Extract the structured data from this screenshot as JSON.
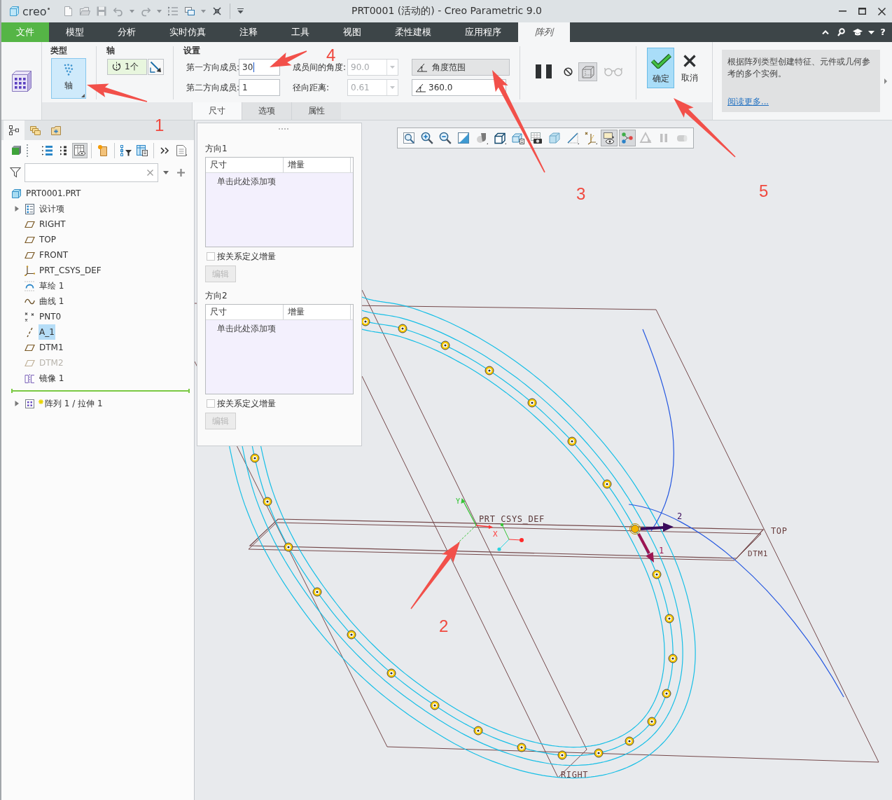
{
  "title_bar": {
    "logo": "creo",
    "title": "PRT0001 (活动的) - Creo Parametric 9.0"
  },
  "menu_bar": {
    "tabs": [
      {
        "label": "文件",
        "kind": "file",
        "selected": false
      },
      {
        "label": "模型",
        "kind": "tab",
        "selected": false
      },
      {
        "label": "分析",
        "kind": "tab",
        "selected": false
      },
      {
        "label": "实时仿真",
        "kind": "tab",
        "selected": false
      },
      {
        "label": "注释",
        "kind": "tab",
        "selected": false
      },
      {
        "label": "工具",
        "kind": "tab",
        "selected": false
      },
      {
        "label": "视图",
        "kind": "tab",
        "selected": false
      },
      {
        "label": "柔性建模",
        "kind": "tab",
        "selected": false
      },
      {
        "label": "应用程序",
        "kind": "tab",
        "selected": false
      },
      {
        "label": "阵列",
        "kind": "tab",
        "selected": true
      }
    ],
    "help_button": "?"
  },
  "ribbon": {
    "type_group": {
      "title": "类型",
      "button": {
        "label": "轴",
        "selected": true
      }
    },
    "axis_group": {
      "title": "轴",
      "collector": "1个"
    },
    "settings_group": {
      "title": "设置",
      "fields": [
        {
          "label": "第一方向成员:",
          "value": "30",
          "kind": "spin",
          "disabled": false,
          "focused": true
        },
        {
          "label": "成员间的角度:",
          "value": "90.0",
          "kind": "combo",
          "disabled": true,
          "focused": false
        },
        {
          "label": "第二方向成员:",
          "value": "1",
          "kind": "spin",
          "disabled": false,
          "focused": false
        },
        {
          "label": "径向距离:",
          "value": "0.61",
          "kind": "combo",
          "disabled": true,
          "focused": false
        }
      ],
      "angle_range_button": "角度范围",
      "angle_value": "360.0"
    },
    "tools": [
      {
        "kind": "pause",
        "pressed": false,
        "disabled": false
      },
      {
        "kind": "stop",
        "pressed": false,
        "disabled": false
      },
      {
        "kind": "preview",
        "pressed": true,
        "disabled": false
      },
      {
        "kind": "verify",
        "pressed": false,
        "disabled": true
      }
    ],
    "confirm_button": "确定",
    "cancel_button": "取消",
    "help": {
      "text": "根据阵列类型创建特征、元件或几何参考的多个实例。",
      "link": "阅读更多..."
    },
    "panel_tabs": [
      {
        "label": "尺寸",
        "selected": true
      },
      {
        "label": "选项",
        "selected": false
      },
      {
        "label": "属性",
        "selected": false
      }
    ]
  },
  "model_tree": {
    "tabs": [
      {
        "kind": "tree",
        "selected": true
      },
      {
        "kind": "layers",
        "selected": false
      },
      {
        "kind": "folder",
        "selected": false
      }
    ],
    "toolbar": [
      {
        "kind": "display",
        "pressed": false
      },
      {
        "kind": "tree-list",
        "pressed": false
      },
      {
        "kind": "expand",
        "pressed": false
      },
      {
        "kind": "columns",
        "pressed": true
      },
      {
        "kind": "highlight",
        "pressed": false
      },
      {
        "kind": "tree-filter",
        "pressed": false
      },
      {
        "kind": "tree-columns",
        "pressed": false
      },
      {
        "kind": "more",
        "pressed": false
      },
      {
        "kind": "settings",
        "pressed": false
      }
    ],
    "root": {
      "label": "PRT0001.PRT",
      "kind": "part",
      "selected": false,
      "children": [
        {
          "label": "设计项",
          "kind": "group",
          "selected": false,
          "greyed": false,
          "new": false,
          "expanded": false
        },
        {
          "label": "RIGHT",
          "kind": "plane",
          "selected": false,
          "greyed": false,
          "new": false
        },
        {
          "label": "TOP",
          "kind": "plane",
          "selected": false,
          "greyed": false,
          "new": false
        },
        {
          "label": "FRONT",
          "kind": "plane",
          "selected": false,
          "greyed": false,
          "new": false
        },
        {
          "label": "PRT_CSYS_DEF",
          "kind": "csys",
          "selected": false,
          "greyed": false,
          "new": false
        },
        {
          "label": "草绘 1",
          "kind": "sketch",
          "selected": false,
          "greyed": false,
          "new": false
        },
        {
          "label": "曲线 1",
          "kind": "curve",
          "selected": false,
          "greyed": false,
          "new": false
        },
        {
          "label": "PNT0",
          "kind": "point",
          "selected": false,
          "greyed": false,
          "new": false
        },
        {
          "label": "A_1",
          "kind": "axis",
          "selected": true,
          "greyed": false,
          "new": false
        },
        {
          "label": "DTM1",
          "kind": "plane",
          "selected": false,
          "greyed": false,
          "new": false
        },
        {
          "label": "DTM2",
          "kind": "plane",
          "selected": false,
          "greyed": true,
          "new": false
        },
        {
          "label": "镜像 1",
          "kind": "mirror",
          "selected": false,
          "greyed": false,
          "new": false
        },
        {
          "label": "阵列 1 / 拉伸 1",
          "kind": "pattern",
          "selected": false,
          "greyed": false,
          "new": true,
          "expanded": false
        }
      ]
    }
  },
  "dimensions_panel": {
    "directions": [
      {
        "title": "方向1",
        "columns": [
          "尺寸",
          "增量"
        ],
        "prompt": "单击此处添加项",
        "relation_checkbox": {
          "label": "按关系定义增量",
          "checked": false
        },
        "edit_button": {
          "label": "编辑",
          "disabled": true
        }
      },
      {
        "title": "方向2",
        "columns": [
          "尺寸",
          "增量"
        ],
        "prompt": "单击此处添加项",
        "relation_checkbox": {
          "label": "按关系定义增量",
          "checked": false
        },
        "edit_button": {
          "label": "编辑",
          "disabled": true
        }
      }
    ]
  },
  "graphics_toolbar": [
    {
      "kind": "refit",
      "pressed": false,
      "disabled": false
    },
    {
      "kind": "zoom-in",
      "pressed": false,
      "disabled": false
    },
    {
      "kind": "zoom-out",
      "pressed": false,
      "disabled": false
    },
    {
      "kind": "repaint",
      "pressed": false,
      "disabled": false
    },
    {
      "kind": "display-style",
      "pressed": false,
      "disabled": false
    },
    {
      "kind": "orientation",
      "pressed": false,
      "disabled": false
    },
    {
      "kind": "view-manager",
      "pressed": false,
      "disabled": false
    },
    {
      "kind": "snapshot",
      "pressed": false,
      "disabled": false
    },
    {
      "kind": "section",
      "pressed": false,
      "disabled": false
    },
    {
      "kind": "plane-display",
      "pressed": false,
      "disabled": false
    },
    {
      "kind": "datum-display",
      "pressed": false,
      "disabled": false
    },
    {
      "kind": "annotation-display",
      "pressed": true,
      "disabled": false
    },
    {
      "kind": "spin-center",
      "pressed": true,
      "disabled": false
    },
    {
      "kind": "play",
      "pressed": false,
      "disabled": true
    },
    {
      "kind": "pause",
      "pressed": false,
      "disabled": true
    },
    {
      "kind": "record",
      "pressed": false,
      "disabled": true
    }
  ],
  "canvas": {
    "labels": [
      "PRT_CSYS_DEF",
      "Y",
      "X",
      "TOP",
      "DTM1",
      "RIGHT",
      "2",
      "1"
    ]
  },
  "annotations": [
    {
      "label": "1"
    },
    {
      "label": "2"
    },
    {
      "label": "3"
    },
    {
      "label": "4"
    },
    {
      "label": "5"
    }
  ]
}
